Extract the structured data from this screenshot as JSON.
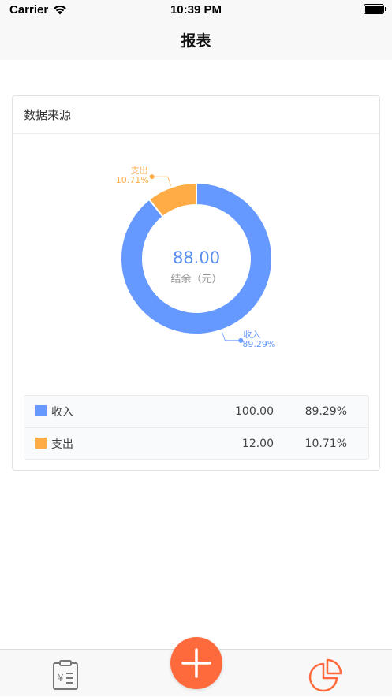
{
  "status_bar": {
    "carrier": "Carrier",
    "time": "10:39 PM"
  },
  "nav": {
    "title": "报表"
  },
  "card": {
    "title": "数据来源"
  },
  "colors": {
    "income": "#6699ff",
    "expense": "#ffac47",
    "accent": "#ff6a3d",
    "center_value": "#5b8def"
  },
  "chart_data": {
    "type": "pie",
    "donut": true,
    "center_value": "88.00",
    "center_label": "结余（元）",
    "slices": [
      {
        "name": "收入",
        "value": 100.0,
        "percent_label": "89.29%",
        "color": "#6699ff"
      },
      {
        "name": "支出",
        "value": 12.0,
        "percent_label": "10.71%",
        "color": "#ffac47"
      }
    ]
  },
  "legend_rows": [
    {
      "name": "收入",
      "amount": "100.00",
      "percent": "89.29%",
      "color": "#6699ff"
    },
    {
      "name": "支出",
      "amount": "12.00",
      "percent": "10.71%",
      "color": "#ffac47"
    }
  ],
  "tab_bar": {
    "left_icon": "bill-list-icon",
    "center_icon": "plus-icon",
    "right_icon": "pie-chart-icon"
  }
}
